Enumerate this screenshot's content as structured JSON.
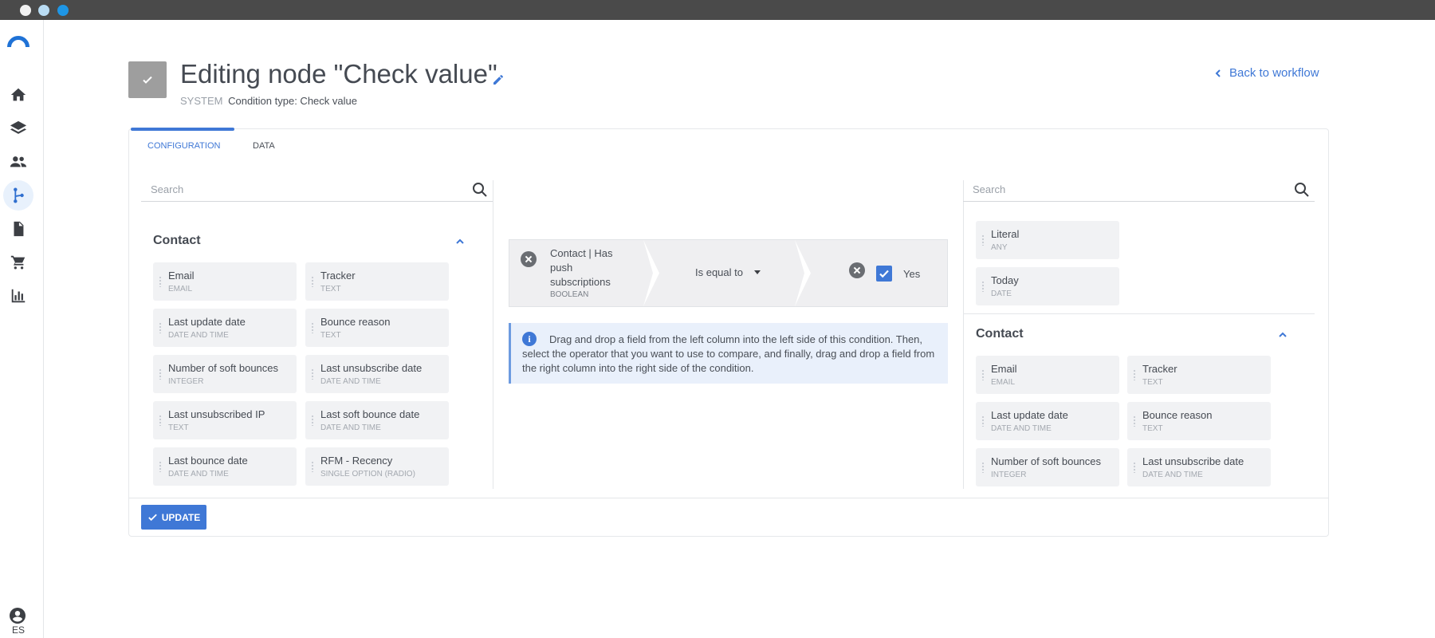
{
  "header": {
    "title": "Editing node \"Check value\"",
    "system_label": "SYSTEM",
    "condition_type": "Condition type: Check value",
    "back_link": "Back to workflow"
  },
  "sidebar": {
    "items": [
      {
        "icon": "home-icon"
      },
      {
        "icon": "layers-icon"
      },
      {
        "icon": "people-icon"
      },
      {
        "icon": "workflow-icon",
        "active": true
      },
      {
        "icon": "document-icon"
      },
      {
        "icon": "cart-icon"
      },
      {
        "icon": "chart-icon"
      }
    ],
    "language": "ES"
  },
  "tabs": [
    {
      "label": "CONFIGURATION",
      "active": true
    },
    {
      "label": "DATA"
    }
  ],
  "left_panel": {
    "search_placeholder": "Search",
    "section_title": "Contact",
    "fields": [
      {
        "name": "Email",
        "type": "EMAIL"
      },
      {
        "name": "Tracker",
        "type": "TEXT"
      },
      {
        "name": "Last update date",
        "type": "DATE AND TIME"
      },
      {
        "name": "Bounce reason",
        "type": "TEXT"
      },
      {
        "name": "Number of soft bounces",
        "type": "INTEGER"
      },
      {
        "name": "Last unsubscribe date",
        "type": "DATE AND TIME"
      },
      {
        "name": "Last unsubscribed IP",
        "type": "TEXT"
      },
      {
        "name": "Last soft bounce date",
        "type": "DATE AND TIME"
      },
      {
        "name": "Last bounce date",
        "type": "DATE AND TIME"
      },
      {
        "name": "RFM - Recency",
        "type": "SINGLE OPTION (RADIO)"
      }
    ]
  },
  "condition": {
    "left_field": "Contact | Has push subscriptions",
    "left_type": "BOOLEAN",
    "operator": "Is equal to",
    "right_value_checked": true,
    "right_value_label": "Yes"
  },
  "info": {
    "text": "Drag and drop a field from the left column into the left side of this condition. Then, select the operator that you want to use to compare, and finally, drag and drop a field from the right column into the right side of the condition."
  },
  "right_panel": {
    "search_placeholder": "Search",
    "constants": [
      {
        "name": "Literal",
        "type": "ANY"
      },
      {
        "name": "Today",
        "type": "DATE"
      }
    ],
    "section_title": "Contact",
    "fields": [
      {
        "name": "Email",
        "type": "EMAIL"
      },
      {
        "name": "Tracker",
        "type": "TEXT"
      },
      {
        "name": "Last update date",
        "type": "DATE AND TIME"
      },
      {
        "name": "Bounce reason",
        "type": "TEXT"
      },
      {
        "name": "Number of soft bounces",
        "type": "INTEGER"
      },
      {
        "name": "Last unsubscribe date",
        "type": "DATE AND TIME"
      }
    ]
  },
  "footer": {
    "update_label": "UPDATE"
  },
  "colors": {
    "accent": "#3f78d6",
    "titlebar": "#4a4a4a",
    "field_bg": "#f1f2f4"
  }
}
